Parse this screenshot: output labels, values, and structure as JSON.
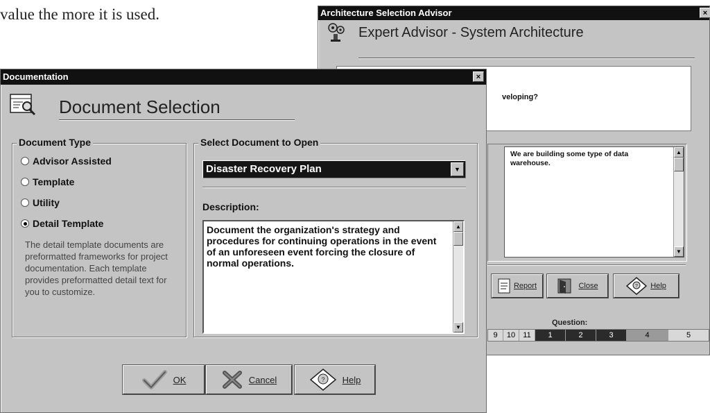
{
  "background_text": "value the more it is used.",
  "advisor": {
    "title": "Architecture Selection Advisor",
    "close_glyph": "×",
    "header": "Expert Advisor - System Architecture",
    "question_text": "veloping?",
    "answer_text": "We are building some type of data warehouse.",
    "buttons": {
      "report": "Report",
      "close": "Close",
      "help": "Help"
    },
    "question_label": "Question:",
    "question_numbers": [
      "9",
      "10",
      "11",
      "1",
      "2",
      "3",
      "4",
      "5"
    ]
  },
  "documentation": {
    "title": "Documentation",
    "close_glyph": "×",
    "header": "Document Selection",
    "doc_type": {
      "label": "Document Type",
      "options": [
        "Advisor Assisted",
        "Template",
        "Utility",
        "Detail Template"
      ],
      "selected": "Detail Template",
      "help_text": "The detail template documents are preformatted frameworks for project documentation. Each template provides preformatted detail text for you to customize."
    },
    "select_doc": {
      "label": "Select Document to Open",
      "dropdown_value": "Disaster Recovery Plan",
      "description_label": "Description:",
      "description_text": "Document the organization's strategy and procedures for continuing operations in the event of an unforeseen event forcing the closure of normal operations."
    },
    "buttons": {
      "ok": "OK",
      "cancel": "Cancel",
      "help": "Help"
    }
  },
  "colors": {
    "titlebar": "#111111",
    "dialog_face": "#c4c4c4",
    "dropdown_bg": "#151515",
    "question_active": "#2b2b2b"
  },
  "icons": [
    "magnifier-document-icon",
    "advisor-gears-icon",
    "report-icon",
    "door-icon",
    "help-diamond-icon",
    "checkmark-icon",
    "x-mark-icon",
    "dropdown-arrow-icon",
    "scroll-up-icon",
    "scroll-down-icon"
  ]
}
